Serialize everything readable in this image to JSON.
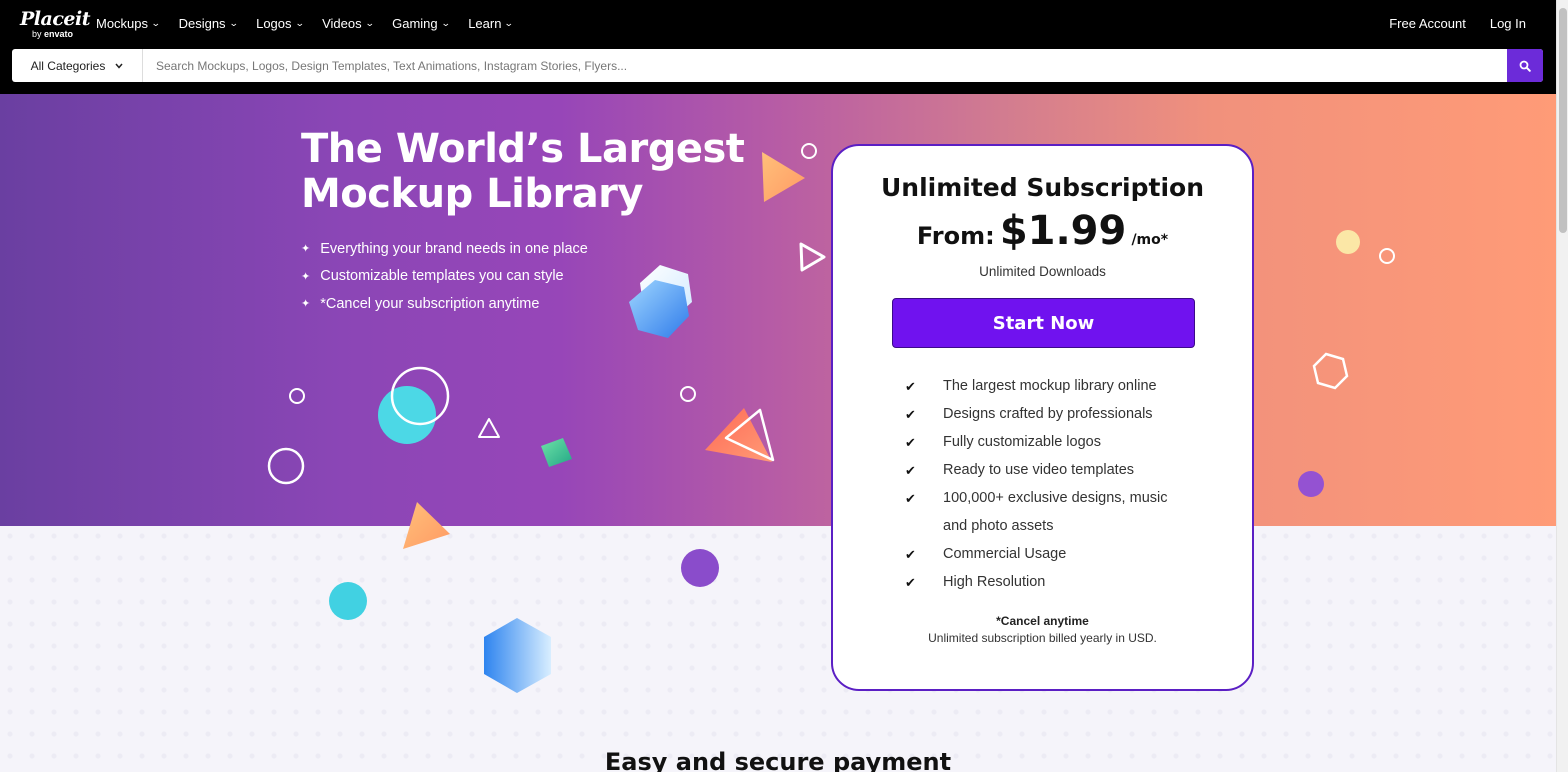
{
  "nav": {
    "logo_name": "Placeit",
    "logo_by": "by",
    "logo_brand": "envato",
    "menu": [
      {
        "label": "Mockups"
      },
      {
        "label": "Designs"
      },
      {
        "label": "Logos"
      },
      {
        "label": "Videos"
      },
      {
        "label": "Gaming"
      },
      {
        "label": "Learn"
      }
    ],
    "free_account": "Free Account",
    "login": "Log In"
  },
  "search": {
    "category": "All Categories",
    "placeholder": "Search Mockups, Logos, Design Templates, Text Animations, Instagram Stories, Flyers..."
  },
  "hero": {
    "title": "The World’s Largest Mockup Library",
    "bullets": [
      "Everything your brand needs in one place",
      "Customizable templates you can style",
      "*Cancel your subscription anytime"
    ]
  },
  "pricing": {
    "title": "Unlimited Subscription",
    "from_label": "From:",
    "price": "$1.99",
    "period": "/mo*",
    "downloads": "Unlimited Downloads",
    "cta": "Start Now",
    "features": [
      "The largest mockup library online",
      "Designs crafted by professionals",
      "Fully customizable logos",
      "Ready to use video templates",
      "100,000+ exclusive designs, music and photo assets",
      "Commercial Usage",
      "High Resolution"
    ],
    "cancel_note": "*Cancel anytime",
    "billed_note": "Unlimited subscription billed yearly in USD."
  },
  "bottom_heading": "Easy and secure payment",
  "colors": {
    "accent": "#7012ef",
    "nav_bg": "#000000",
    "card_border": "#5b1fc4"
  },
  "icons": {
    "search": "search-icon",
    "check": "check-icon",
    "chevron": "chevron-down-icon"
  }
}
